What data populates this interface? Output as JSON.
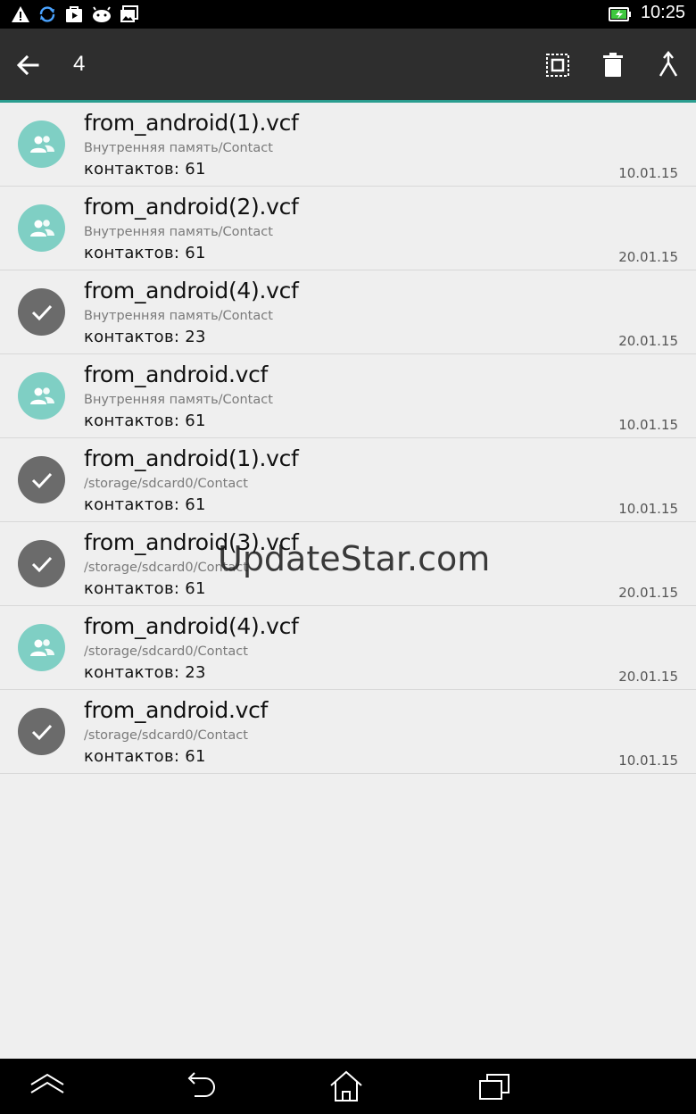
{
  "status_bar": {
    "time": "10:25",
    "icons": [
      "warning-icon",
      "sync-icon",
      "play-store-icon",
      "android-icon",
      "gallery-icon"
    ],
    "battery": "battery-charging-icon"
  },
  "action_bar": {
    "selected_count": "4",
    "actions": [
      "select-all-icon",
      "delete-icon",
      "merge-icon"
    ],
    "accent_color": "#2a9d8f",
    "background_color": "#2e2e2e"
  },
  "files": [
    {
      "name": "from_android(1).vcf",
      "path": "Внутренняя память/Contact",
      "count": "контактов: 61",
      "date": "10.01.15",
      "selected": false
    },
    {
      "name": "from_android(2).vcf",
      "path": "Внутренняя память/Contact",
      "count": "контактов: 61",
      "date": "20.01.15",
      "selected": false
    },
    {
      "name": "from_android(4).vcf",
      "path": "Внутренняя память/Contact",
      "count": "контактов: 23",
      "date": "20.01.15",
      "selected": true
    },
    {
      "name": "from_android.vcf",
      "path": "Внутренняя память/Contact",
      "count": "контактов: 61",
      "date": "10.01.15",
      "selected": false
    },
    {
      "name": "from_android(1).vcf",
      "path": "/storage/sdcard0/Contact",
      "count": "контактов: 61",
      "date": "10.01.15",
      "selected": true
    },
    {
      "name": "from_android(3).vcf",
      "path": "/storage/sdcard0/Contact",
      "count": "контактов: 61",
      "date": "20.01.15",
      "selected": true
    },
    {
      "name": "from_android(4).vcf",
      "path": "/storage/sdcard0/Contact",
      "count": "контактов: 23",
      "date": "20.01.15",
      "selected": false
    },
    {
      "name": "from_android.vcf",
      "path": "/storage/sdcard0/Contact",
      "count": "контактов: 61",
      "date": "10.01.15",
      "selected": true
    }
  ],
  "colors": {
    "contact_avatar": "#7fcfc4",
    "selected_avatar": "#6b6b6b"
  },
  "watermark": "UpdateStar.com",
  "nav_bar": {
    "buttons": [
      "nav-up-icon",
      "nav-back-icon",
      "nav-home-icon",
      "nav-recents-icon"
    ]
  }
}
